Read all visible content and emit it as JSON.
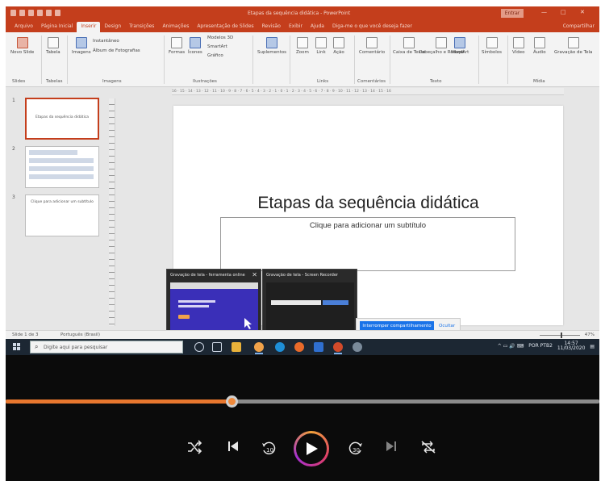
{
  "powerpoint": {
    "title": "Etapas da sequência didática - PowerPoint",
    "signin_label": "Entrar",
    "window_controls": [
      "—",
      "□",
      "✕"
    ],
    "tabs": [
      {
        "label": "Arquivo",
        "active": false
      },
      {
        "label": "Página Inicial",
        "active": false
      },
      {
        "label": "Inserir",
        "active": true
      },
      {
        "label": "Design",
        "active": false
      },
      {
        "label": "Transições",
        "active": false
      },
      {
        "label": "Animações",
        "active": false
      },
      {
        "label": "Apresentação de Slides",
        "active": false
      },
      {
        "label": "Revisão",
        "active": false
      },
      {
        "label": "Exibir",
        "active": false
      },
      {
        "label": "Ajuda",
        "active": false
      },
      {
        "label": "Diga-me o que você deseja fazer",
        "active": false
      }
    ],
    "share_label": "Compartilhar",
    "ribbon": {
      "new_slide": "Novo Slide",
      "table": "Tabela",
      "images": "Imagens",
      "screenshot": "Instantâneo",
      "photo_album": "Álbum de Fotografias",
      "forms": "Formas",
      "icons": "Ícones",
      "models_3d": "Modelos 3D",
      "smartart": "SmartArt",
      "chart": "Gráfico",
      "addins": "Suplementos",
      "zoom": "Zoom",
      "link": "Link",
      "action": "Ação",
      "comment": "Comentário",
      "textbox": "Caixa de Texto",
      "header_footer": "Cabeçalho e Rodapé",
      "wordart": "WordArt",
      "symbols": "Símbolos",
      "video": "Vídeo",
      "audio": "Áudio",
      "screen_recording": "Gravação de Tela",
      "groups": {
        "slides": "Slides",
        "tables": "Tabelas",
        "images": "Imagens",
        "illustrations": "Ilustrações",
        "links": "Links",
        "comments": "Comentários",
        "text": "Texto",
        "media": "Mídia"
      }
    },
    "ruler_text": "16 · 15 · 14 · 13 · 12 · 11 · 10 · 9 · 8 · 7 · 6 · 5 · 4 · 3 · 2 · 1 · 0 · 1 · 2 · 3 · 4 · 5 · 6 · 7 · 8 · 9 · 10 · 11 · 12 · 13 · 14 · 15 · 16",
    "thumbnails": [
      {
        "number": "1",
        "title": "Etapas da sequência didática"
      },
      {
        "number": "2",
        "title": ""
      },
      {
        "number": "3",
        "title": "Clique para adicionar um subtítulo"
      }
    ],
    "slide": {
      "title": "Etapas da sequência didática",
      "subtitle_placeholder": "Clique para adicionar um subtítulo"
    },
    "statusbar": {
      "slide_count": "Slide 1 de 3",
      "language": "Português (Brasil)",
      "zoom": "47%"
    }
  },
  "previews": [
    {
      "title": "Gravação de tela - ferramenta online",
      "close": "✕"
    },
    {
      "title": "Gravação de tela - Screen Recorder",
      "close": ""
    }
  ],
  "share_bar": {
    "stop_label": "Interromper compartilhamento",
    "hide_label": "Ocultar"
  },
  "taskbar": {
    "search_placeholder": "Digite aqui para pesquisar",
    "tray_text": "^ ▭ 🔊 ⌨",
    "lang": "POR PTB2",
    "time": "14:57",
    "date": "11/03/2020"
  },
  "player": {
    "progress": 0.38
  },
  "colors": {
    "ppt_accent": "#c43e1c",
    "progress": "#e8772e",
    "player_bg": "#0b0b0b"
  }
}
